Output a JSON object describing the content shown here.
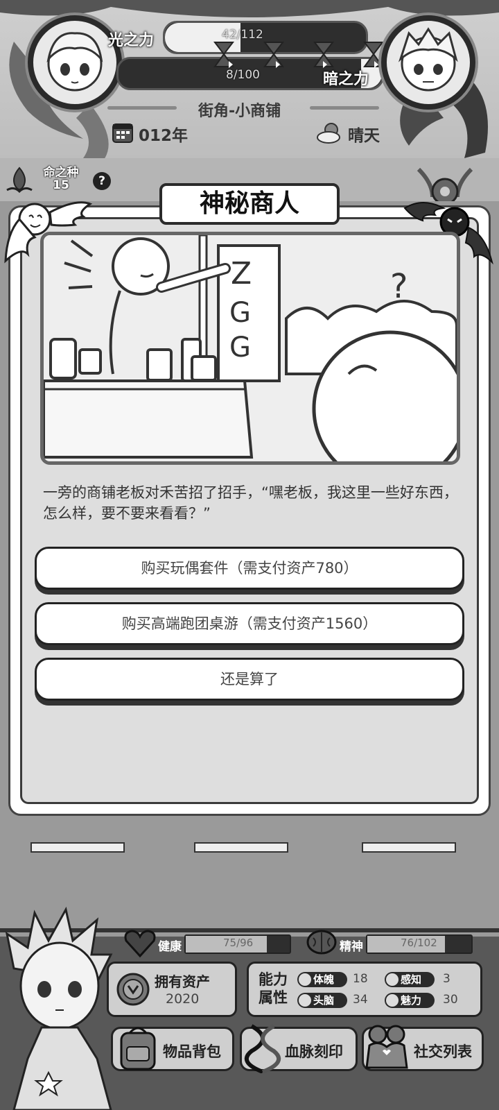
{
  "header": {
    "light_label": "光之力",
    "dark_label": "暗之力",
    "light_progress": "42/112",
    "dark_progress": "8/100",
    "light_fraction": 0.375,
    "dark_fraction": 0.08,
    "location": "街角-小商铺",
    "year": "012年",
    "weather": "晴天"
  },
  "seed": {
    "label": "命之种",
    "count": "15",
    "help": "?"
  },
  "event": {
    "title": "神秘商人",
    "description": "一旁的商铺老板对禾苦招了招手，“嘿老板，我这里一些好东西，怎么样，要不要来看看？”",
    "choices": [
      "购买玩偶套件（需支付资产780）",
      "购买高端跑团桌游（需支付资产1560）",
      "还是算了"
    ]
  },
  "stats": {
    "health_label": "健康",
    "health_value": "75/96",
    "health_fraction": 0.78,
    "spirit_label": "精神",
    "spirit_value": "76/102",
    "spirit_fraction": 0.745,
    "assets_label": "拥有资产",
    "assets_value": "2020",
    "ability_label_1": "能力",
    "ability_label_2": "属性",
    "attributes": [
      {
        "name": "体魄",
        "value": "18"
      },
      {
        "name": "感知",
        "value": "3"
      },
      {
        "name": "头脑",
        "value": "34"
      },
      {
        "name": "魅力",
        "value": "30"
      }
    ]
  },
  "buttons": {
    "inventory": "物品背包",
    "bloodline": "血脉刻印",
    "social": "社交列表"
  },
  "colors": {
    "background": "#9a9a9a",
    "dialog": "#dedede",
    "bottom_panel": "#585858"
  }
}
